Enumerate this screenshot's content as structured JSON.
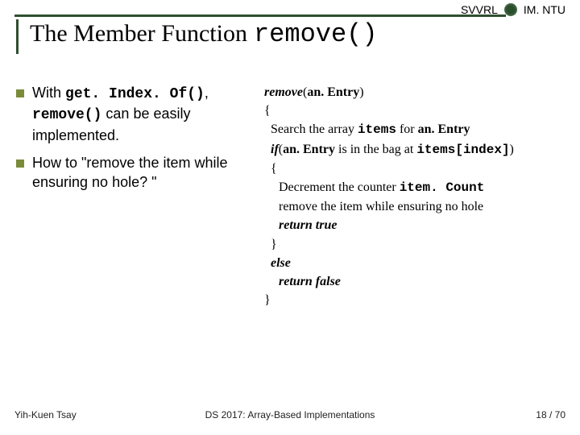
{
  "header": {
    "svvrl": "SVVRL",
    "imntu": "IM. NTU"
  },
  "title": {
    "prefix": "The Member Function",
    "code": "remove()"
  },
  "bullets": [
    {
      "pre": "With ",
      "code1": "get. Index. Of()",
      "mid1": ", ",
      "code2": "remove()",
      "mid2": " can be easily implemented."
    },
    {
      "pre": "How to \"remove the item while ensuring no hole? \"",
      "code1": "",
      "mid1": "",
      "code2": "",
      "mid2": ""
    }
  ],
  "pseudo": {
    "l0a": "remove",
    "l0b": "(",
    "l0c": "an. Entry",
    "l0d": ")",
    "l1": "{",
    "l2a": "Search the array ",
    "l2b": "items",
    "l2c": " for ",
    "l2d": "an. Entry",
    "l3a": "if",
    "l3b": "(",
    "l3c": "an. Entry",
    "l3d": " is in the bag at ",
    "l3e": "items[index]",
    "l3f": ")",
    "l4": "{",
    "l5a": "Decrement the counter ",
    "l5b": "item. Count",
    "l6": "remove the item while ensuring no hole",
    "l7": "return true",
    "l8": "}",
    "l9": "else",
    "l10": "return false",
    "l11": "}"
  },
  "footer": {
    "left": "Yih-Kuen Tsay",
    "mid": "DS 2017: Array-Based Implementations",
    "right": "18 / 70"
  }
}
